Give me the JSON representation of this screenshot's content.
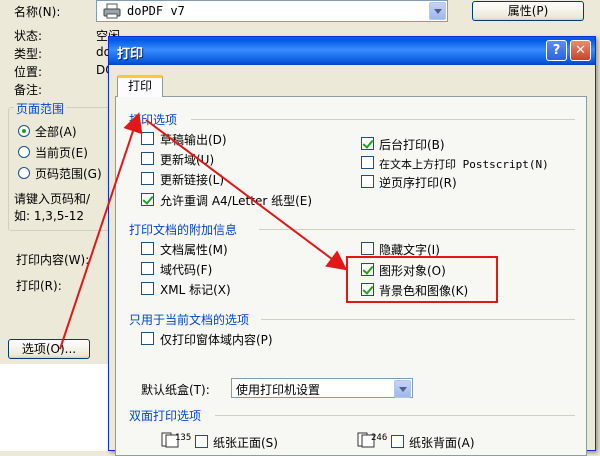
{
  "background": {
    "name_label": "名称(N):",
    "printer_name": "doPDF v7",
    "properties_button": "属性(P)",
    "status_label": "状态:",
    "status_value": "空闲",
    "type_label": "类型:",
    "type_value": "do",
    "location_label": "位置:",
    "location_value": "DO",
    "comment_label": "备注:",
    "page_range_title": "页面范围",
    "radio_all": "全部(A)",
    "radio_current": "当前页(E)",
    "radio_pages": "页码范围(G)",
    "hint_line1": "请键入页码和/",
    "hint_line2": "如: 1,3,5-12",
    "print_content_label": "打印内容(W):",
    "print_label": "打印(R):",
    "options_button": "选项(O)..."
  },
  "dialog": {
    "title": "打印",
    "help_button": "?",
    "close_button": "✕",
    "tab_label": "打印",
    "section_print_options": "打印选项",
    "opt_draft": "草稿输出(D)",
    "opt_update_fields": "更新域(U)",
    "opt_update_links": "更新链接(L)",
    "opt_allow_a4": "允许重调 A4/Letter 纸型(E)",
    "opt_background": "后台打印(B)",
    "opt_postscript": "在文本上方打印 Postscript(N)",
    "opt_reverse": "逆页序打印(R)",
    "section_extra_info": "打印文档的附加信息",
    "opt_doc_props": "文档属性(M)",
    "opt_field_codes": "域代码(F)",
    "opt_xml_tags": "XML 标记(X)",
    "opt_hidden_text": "隐藏文字(I)",
    "opt_drawing_objects": "图形对象(O)",
    "opt_bg_colors": "背景色和图像(K)",
    "section_current_doc": "只用于当前文档的选项",
    "opt_form_data_only": "仅打印窗体域内容(P)",
    "tray_label": "默认纸盒(T):",
    "tray_value": "使用打印机设置",
    "section_duplex": "双面打印选项",
    "opt_front": "纸张正面(S)",
    "opt_back": "纸张背面(A)",
    "duplex_front_icon_text": "135",
    "duplex_back_icon_text": "246"
  },
  "colors": {
    "annotation": "#e01818",
    "group_title": "#0046d5",
    "check": "#21a121"
  }
}
